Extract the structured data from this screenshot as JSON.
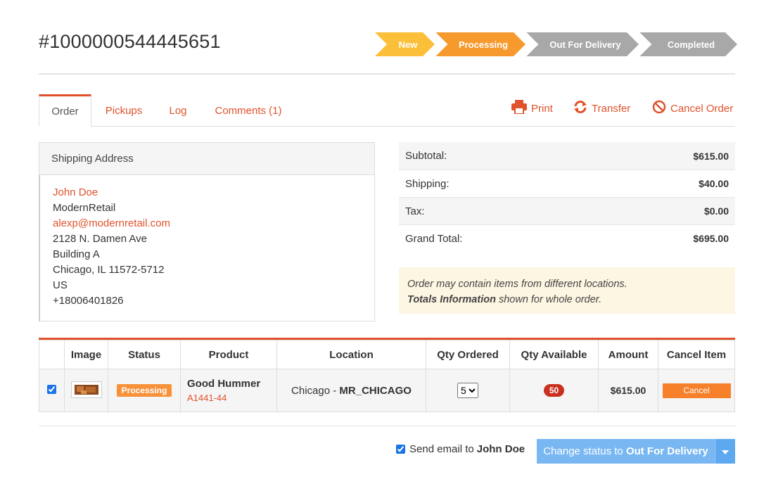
{
  "order": {
    "number": "#1000000544445651"
  },
  "progress": {
    "steps": [
      {
        "label": "New",
        "color": "#fbbf3a"
      },
      {
        "label": "Processing",
        "color": "#f79a2e"
      },
      {
        "label": "Out For Delivery",
        "color": "#a8a8a8"
      },
      {
        "label": "Completed",
        "color": "#a8a8a8"
      }
    ]
  },
  "tabs": [
    {
      "label": "Order",
      "active": true
    },
    {
      "label": "Pickups"
    },
    {
      "label": "Log"
    },
    {
      "label": "Comments (1)"
    }
  ],
  "actions": {
    "print": "Print",
    "transfer": "Transfer",
    "cancel_order": "Cancel Order"
  },
  "shipping": {
    "title": "Shipping Address",
    "name": "John Doe",
    "company": "ModernRetail",
    "email": "alexp@modernretail.com",
    "street": "2128 N. Damen Ave",
    "building": "Building A",
    "city": "Chicago, IL 11572-5712",
    "country": "US",
    "phone": "+18006401826"
  },
  "totals": [
    {
      "label": "Subtotal:",
      "value": "$615.00"
    },
    {
      "label": "Shipping:",
      "value": "$40.00"
    },
    {
      "label": "Tax:",
      "value": "$0.00"
    },
    {
      "label": "Grand Total:",
      "value": "$695.00"
    }
  ],
  "notice": {
    "line1": "Order may contain items from different locations.",
    "line2_bold": "Totals Information",
    "line2_rest": " shown for whole order."
  },
  "items_table": {
    "headers": [
      "Image",
      "Status",
      "Product",
      "Location",
      "Qty Ordered",
      "Qty Available",
      "Amount",
      "Cancel Item"
    ],
    "rows": [
      {
        "checked": true,
        "status": "Processing",
        "product_name": "Good Hummer",
        "sku": "A1441-44",
        "location_city": "Chicago - ",
        "location_code": "MR_CHICAGO",
        "qty_ordered": "5",
        "qty_available": "50",
        "amount": "$615.00",
        "cancel_label": "Cancel"
      }
    ]
  },
  "footer": {
    "send_email_label": "Send email to ",
    "send_email_name": "John Doe",
    "change_status_prefix": "Change status to ",
    "change_status_target": "Out For Delivery"
  }
}
